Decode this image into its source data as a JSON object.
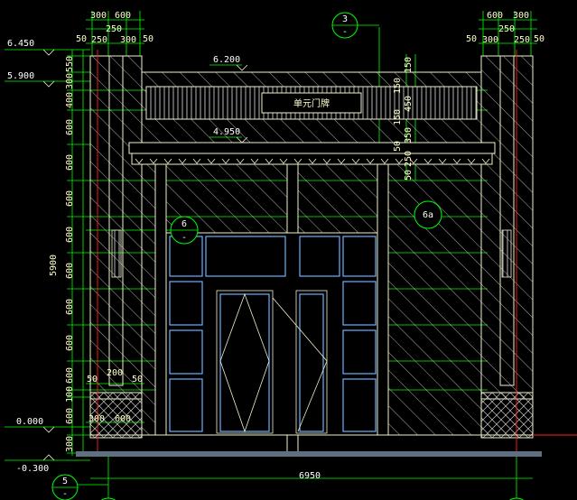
{
  "drawing": {
    "sign_text": "单元门牌",
    "elevations": {
      "top": "6.450",
      "eave": "5.900",
      "sign_top": "6.200",
      "canopy": "4.950",
      "ground": "0.000",
      "base": "-0.300"
    },
    "dims_top_left": {
      "a": "300",
      "b": "600",
      "c": "50",
      "d": "250",
      "e": "250",
      "f": "300",
      "g": "50"
    },
    "dims_top_right": {
      "a": "600",
      "b": "300",
      "c": "50",
      "d": "250",
      "e": "300",
      "f": "250",
      "g": "50"
    },
    "dims_left": [
      "550",
      "300",
      "400",
      "600",
      "600",
      "600",
      "600",
      "600",
      "600",
      "600",
      "600",
      "100",
      "600",
      "300"
    ],
    "dim_total_height": "5900",
    "dims_sign_right": [
      "150",
      "150",
      "150",
      "450",
      "50",
      "350",
      "250",
      "50"
    ],
    "dims_pier_left": {
      "a": "50",
      "b": "200",
      "c": "50",
      "d": "300",
      "e": "600"
    },
    "dim_total_width": "6950",
    "callouts": {
      "top": {
        "num": "3",
        "sub": "-"
      },
      "left": {
        "num": "6",
        "sub": "-"
      },
      "right": {
        "num": "6a",
        "sub": ""
      },
      "bottom": {
        "num": "5",
        "sub": "-"
      }
    },
    "colors": {
      "background": "#000000",
      "line": "#f0f0c8",
      "hatch": "#e8e8e8",
      "green": "#00ff00",
      "red": "#ff2020",
      "glass": "#6ab0ff",
      "ground": "#607080"
    }
  }
}
